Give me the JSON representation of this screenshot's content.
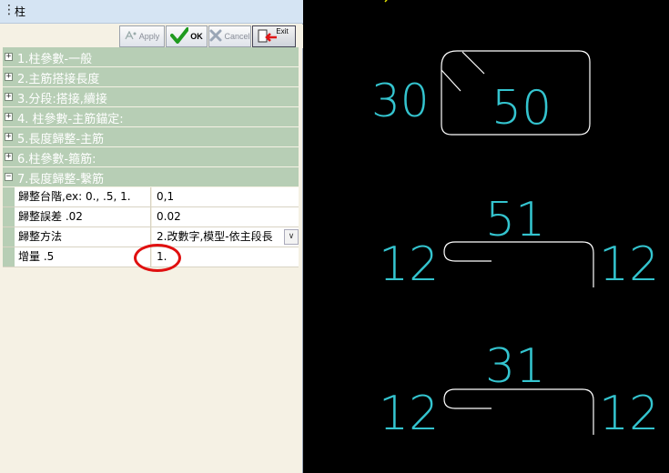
{
  "window": {
    "title": "柱",
    "grip": "⋮"
  },
  "toolbar": {
    "apply_label": "Apply",
    "ok_label": "OK",
    "cancel_label": "Cancel",
    "exit_label": "Exit"
  },
  "groups": [
    {
      "label": "1.柱參數-一般",
      "expanded": false
    },
    {
      "label": "2.主筋搭接長度",
      "expanded": false
    },
    {
      "label": "3.分段:搭接,續接",
      "expanded": false
    },
    {
      "label": "4. 柱參數-主筋錨定:",
      "expanded": false
    },
    {
      "label": "5.長度歸整-主筋",
      "expanded": false
    },
    {
      "label": "6.柱參數-箍筋:",
      "expanded": false
    },
    {
      "label": "7.長度歸整-繫筋",
      "expanded": true
    }
  ],
  "properties": [
    {
      "name": "歸整台階,ex: 0., .5, 1.",
      "value": "0,1"
    },
    {
      "name": "歸整誤差 .02",
      "value": "0.02"
    },
    {
      "name": "歸整方法",
      "value": "2.改數字,模型-依主段長"
    },
    {
      "name": "增量 .5",
      "value": "1."
    }
  ],
  "cad": {
    "line_color": "#ffffff",
    "text_color": "#34c4cf",
    "accent_color": "#e0e000",
    "hook_shape": {
      "left_label": "30",
      "inner_label": "50"
    },
    "tie_upper": {
      "top_label": "51",
      "left_label": "12",
      "right_label": "12"
    },
    "tie_lower": {
      "top_label": "31",
      "left_label": "12",
      "right_label": "12"
    }
  }
}
